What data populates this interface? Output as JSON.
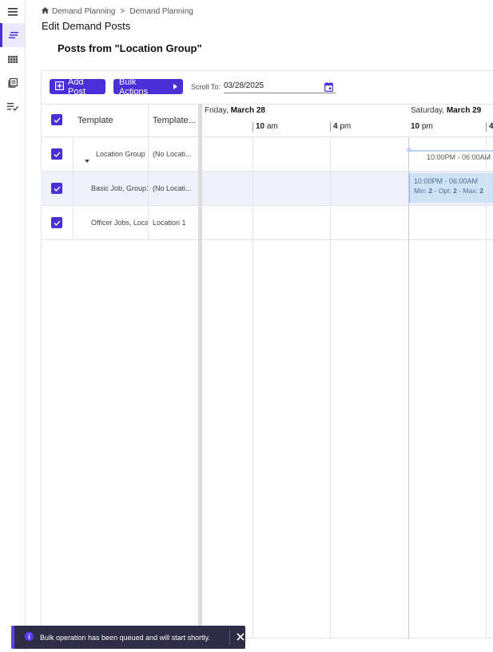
{
  "nav_rail": {
    "items": [
      {
        "icon": "menu-icon"
      },
      {
        "icon": "demand-posts-icon",
        "active": true
      },
      {
        "icon": "grid-icon"
      },
      {
        "icon": "library-icon"
      },
      {
        "icon": "checklist-icon"
      }
    ]
  },
  "breadcrumb": {
    "home_icon": "home-icon",
    "crumb1": "Demand Planning",
    "separator": ">",
    "crumb2": "Demand Planning"
  },
  "page_title": "Edit Demand Posts",
  "section_title": "Posts from \"Location Group\"",
  "toolbar": {
    "add_post_label": "Add Post",
    "bulk_actions_label": "Bulk Actions",
    "scroll_to_label": "Scroll To:",
    "scroll_to_value": "03/28/2025"
  },
  "table": {
    "columns": [
      "Template",
      "Template..."
    ],
    "rows": [
      {
        "template": "Location Group",
        "template2": "(No Locati...",
        "checked": true,
        "expandable": true
      },
      {
        "template": "Basic Job, Group1",
        "template2": "(No Locati...",
        "checked": true
      },
      {
        "template": "Officer Jobs, Loca",
        "template2": "Location 1",
        "checked": true
      }
    ]
  },
  "timeline": {
    "days": [
      {
        "weekday": "Friday,",
        "date": "March 28"
      },
      {
        "weekday": "Saturday,",
        "date": "March 29"
      }
    ],
    "times": [
      {
        "hour": "10",
        "suffix": " am"
      },
      {
        "hour": "4",
        "suffix": " pm"
      },
      {
        "hour": "10",
        "suffix": " pm"
      },
      {
        "hour": "4",
        "suffix": ""
      }
    ],
    "group_shift": "10:00PM - 06:00AM",
    "shift": {
      "time": "10:00PM - 06:00AM",
      "min_label": "Min: ",
      "min": "2",
      "opt_label": " - Opt: ",
      "opt": "2",
      "max_label": " - Max: ",
      "max": "2"
    }
  },
  "toast": {
    "message": "Bulk operation has been queued and will start shortly."
  },
  "colors": {
    "accent": "#4b2fd6",
    "shift_fill": "#cfe2f6",
    "toast_bg": "#2f2d45"
  }
}
